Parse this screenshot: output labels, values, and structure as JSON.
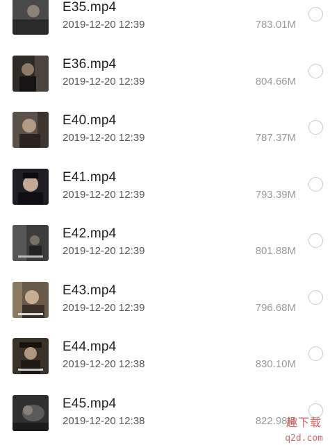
{
  "files": [
    {
      "name": "E35.mp4",
      "date": "2019-12-20 12:39",
      "size": "783.01M",
      "thumb_icon": "video-thumbnail-icon",
      "tone": "#4a4a4a"
    },
    {
      "name": "E36.mp4",
      "date": "2019-12-20 12:39",
      "size": "804.66M",
      "thumb_icon": "video-thumbnail-icon",
      "tone": "#2e2a26"
    },
    {
      "name": "E40.mp4",
      "date": "2019-12-20 12:39",
      "size": "787.37M",
      "thumb_icon": "video-thumbnail-icon",
      "tone": "#5a5148"
    },
    {
      "name": "E41.mp4",
      "date": "2019-12-20 12:39",
      "size": "793.39M",
      "thumb_icon": "video-thumbnail-icon",
      "tone": "#1e1e24"
    },
    {
      "name": "E42.mp4",
      "date": "2019-12-20 12:39",
      "size": "801.88M",
      "thumb_icon": "video-thumbnail-icon",
      "tone": "#3c3c3c"
    },
    {
      "name": "E43.mp4",
      "date": "2019-12-20 12:39",
      "size": "796.68M",
      "thumb_icon": "video-thumbnail-icon",
      "tone": "#6a5a4a"
    },
    {
      "name": "E44.mp4",
      "date": "2019-12-20 12:38",
      "size": "830.10M",
      "thumb_icon": "video-thumbnail-icon",
      "tone": "#3a3228"
    },
    {
      "name": "E45.mp4",
      "date": "2019-12-20 12:38",
      "size": "822.98M",
      "thumb_icon": "video-thumbnail-icon",
      "tone": "#2f2f2f"
    }
  ],
  "watermark": {
    "logo": "趣下载",
    "url": "q2d.com"
  },
  "colors": {
    "radio_border": "#c8c8c8",
    "name_text": "#222222",
    "meta_text": "#555555",
    "size_text": "#9a9a9a"
  }
}
